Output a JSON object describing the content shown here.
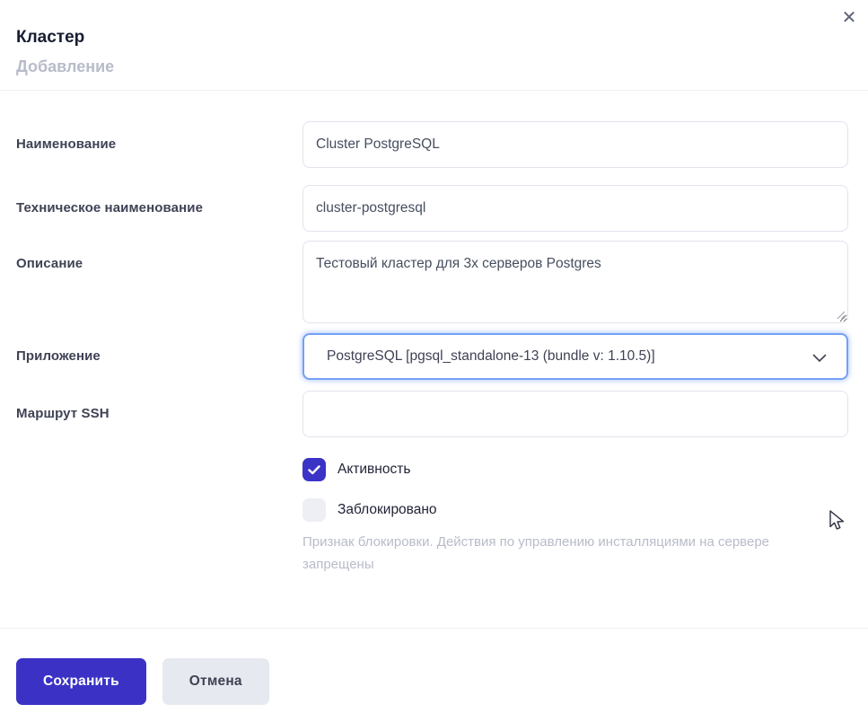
{
  "modal": {
    "title": "Кластер",
    "subtitle": "Добавление"
  },
  "icons": {
    "close": "✕",
    "check": "✓",
    "chevron_down": "chevron-down",
    "resize_grip": "resize-grip",
    "mouse_cursor": "arrow-pointer"
  },
  "form": {
    "name": {
      "label": "Наименование",
      "value": "Cluster PostgreSQL"
    },
    "tech_name": {
      "label": "Техническое наименование",
      "value": "cluster-postgresql"
    },
    "description": {
      "label": "Описание",
      "value": "Тестовый кластер для 3х серверов Postgres"
    },
    "application": {
      "label": "Приложение",
      "value": "PostgreSQL [pgsql_standalone-13 (bundle v: 1.10.5)]",
      "focused": true
    },
    "ssh_route": {
      "label": "Маршрут SSH",
      "value": "",
      "placeholder": ""
    },
    "activity": {
      "label": "Активность",
      "checked": true
    },
    "blocked": {
      "label": "Заблокировано",
      "checked": false,
      "hint": "Признак блокировки. Действия по управлению инсталляциями на сервере запрещены"
    }
  },
  "footer": {
    "save_label": "Сохранить",
    "cancel_label": "Отмена"
  },
  "colors": {
    "primary": "#3b32c5",
    "focus_border": "#74a0f6",
    "muted_text": "#b8bcc9",
    "label_text": "#3f4254",
    "divider": "#eff0f3",
    "checkbox_unchecked_bg": "#edeff4"
  }
}
